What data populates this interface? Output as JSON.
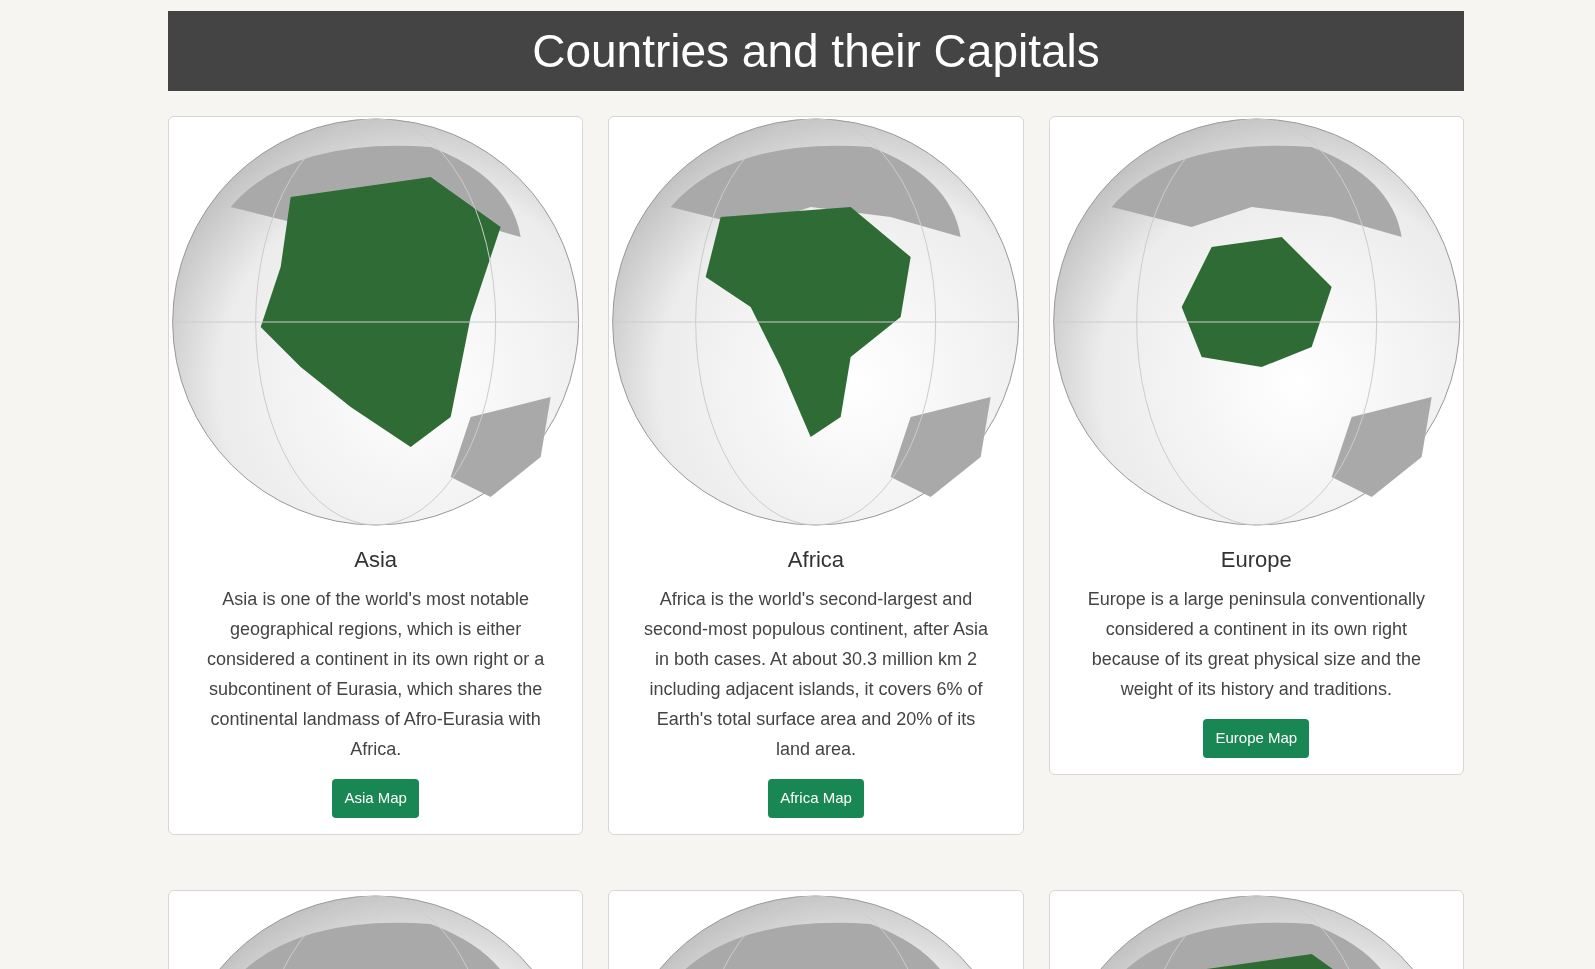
{
  "header": {
    "title": "Countries and their Capitals"
  },
  "cards": [
    {
      "title": "Asia",
      "text": "Asia is one of the world's most notable geographical regions, which is either considered a continent in its own right or a subcontinent of Eurasia, which shares the continental landmass of Afro-Eurasia with Africa.",
      "button": "Asia Map"
    },
    {
      "title": "Africa",
      "text": "Africa is the world's second-largest and second-most populous continent, after Asia in both cases. At about 30.3 million km 2 including adjacent islands, it covers 6% of Earth's total surface area and 20% of its land area.",
      "button": "Africa Map"
    },
    {
      "title": "Europe",
      "text": "Europe is a large peninsula conventionally considered a continent in its own right because of its great physical size and the weight of its history and traditions.",
      "button": "Europe Map"
    }
  ]
}
